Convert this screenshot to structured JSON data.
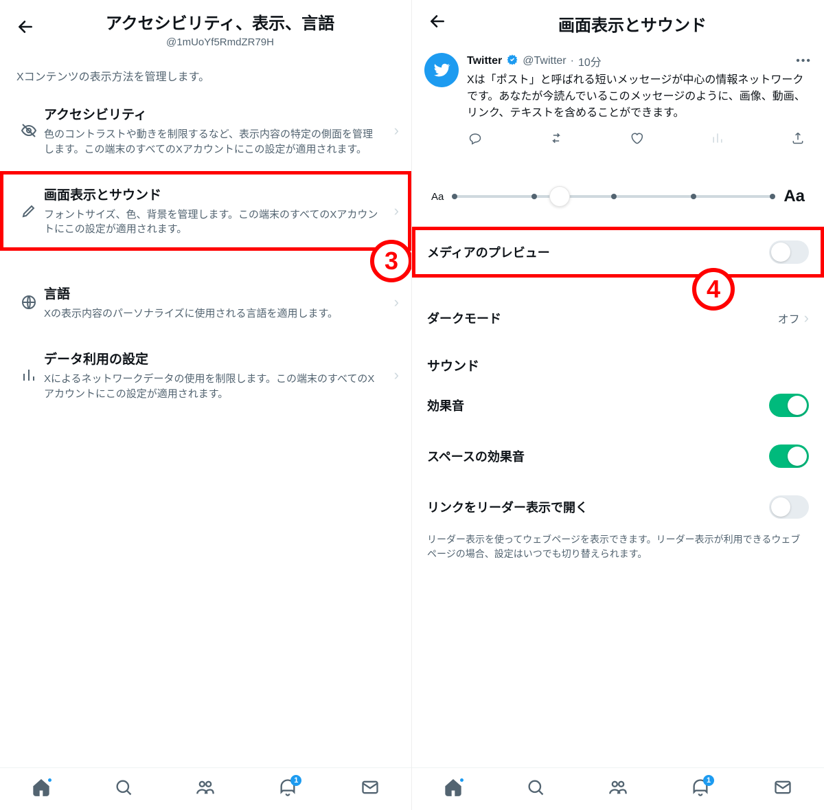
{
  "left": {
    "title": "アクセシビリティ、表示、言語",
    "username": "@1mUoYf5RmdZR79H",
    "description": "Xコンテンツの表示方法を管理します。",
    "items": [
      {
        "title": "アクセシビリティ",
        "sub": "色のコントラストや動きを制限するなど、表示内容の特定の側面を管理します。この端末のすべてのXアカウントにこの設定が適用されます。"
      },
      {
        "title": "画面表示とサウンド",
        "sub": "フォントサイズ、色、背景を管理します。この端末のすべてのXアカウントにこの設定が適用されます。"
      },
      {
        "title": "言語",
        "sub": "Xの表示内容のパーソナライズに使用される言語を適用します。"
      },
      {
        "title": "データ利用の設定",
        "sub": "Xによるネットワークデータの使用を制限します。この端末のすべてのXアカウントにこの設定が適用されます。"
      }
    ],
    "callout": "3"
  },
  "right": {
    "title": "画面表示とサウンド",
    "tweet": {
      "name": "Twitter",
      "handle": "@Twitter",
      "time": "10分",
      "text": "Xは「ポスト」と呼ばれる短いメッセージが中心の情報ネットワークです。あなたが今読んでいるこのメッセージのように、画像、動画、リンク、テキストを含めることができます。"
    },
    "slider": {
      "smallLabel": "Aa",
      "largeLabel": "Aa"
    },
    "mediaPreview": {
      "label": "メディアのプレビュー",
      "on": false
    },
    "darkMode": {
      "label": "ダークモード",
      "value": "オフ"
    },
    "soundHeader": "サウンド",
    "soundEffects": {
      "label": "効果音",
      "on": true
    },
    "spacesSounds": {
      "label": "スペースの効果音",
      "on": true
    },
    "readerView": {
      "label": "リンクをリーダー表示で開く",
      "on": false,
      "sub": "リーダー表示を使ってウェブページを表示できます。リーダー表示が利用できるウェブページの場合、設定はいつでも切り替えられます。"
    },
    "callout": "4"
  },
  "tabbar": {
    "bellCount": "1"
  }
}
